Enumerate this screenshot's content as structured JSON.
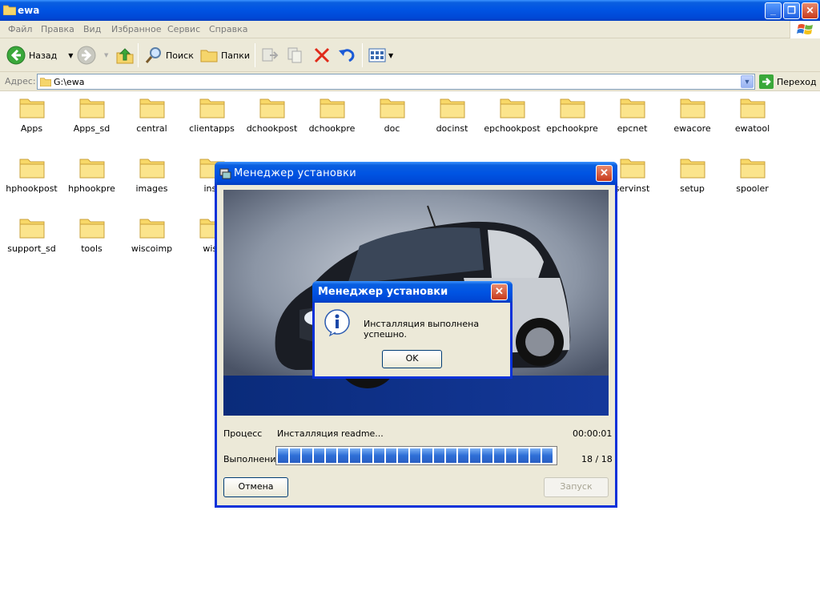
{
  "window": {
    "title": "ewa"
  },
  "menu": [
    "Файл",
    "Правка",
    "Вид",
    "Избранное",
    "Сервис",
    "Справка"
  ],
  "toolbar": {
    "back_label": "Назад",
    "search_label": "Поиск",
    "folders_label": "Папки"
  },
  "address": {
    "label": "Адрес:",
    "value": "G:\\ewa",
    "go_label": "Переход"
  },
  "folders": [
    "Apps",
    "Apps_sd",
    "central",
    "clientapps",
    "dchookpost",
    "dchookpre",
    "doc",
    "docinst",
    "epchookpost",
    "epchookpre",
    "epcnet",
    "ewacore",
    "ewatool",
    "hphookpost",
    "hphookpre",
    "images",
    "inst",
    "",
    "",
    "",
    "",
    "",
    "",
    "servinst",
    "setup",
    "spooler",
    "support_sd",
    "tools",
    "wiscoimp",
    "wisr"
  ],
  "installer": {
    "title": "Менеджер установки",
    "process_label": "Процесс",
    "process_value": "Инсталляция readme...",
    "time": "00:00:01",
    "progress_label": "Выполнение",
    "progress_value": "18 / 18",
    "progress_fraction": 1.0,
    "cancel_label": "Отмена",
    "start_label": "Запуск"
  },
  "message": {
    "title": "Менеджер установки",
    "text": "Инсталляция выполнена успешно.",
    "ok_label": "OK"
  }
}
